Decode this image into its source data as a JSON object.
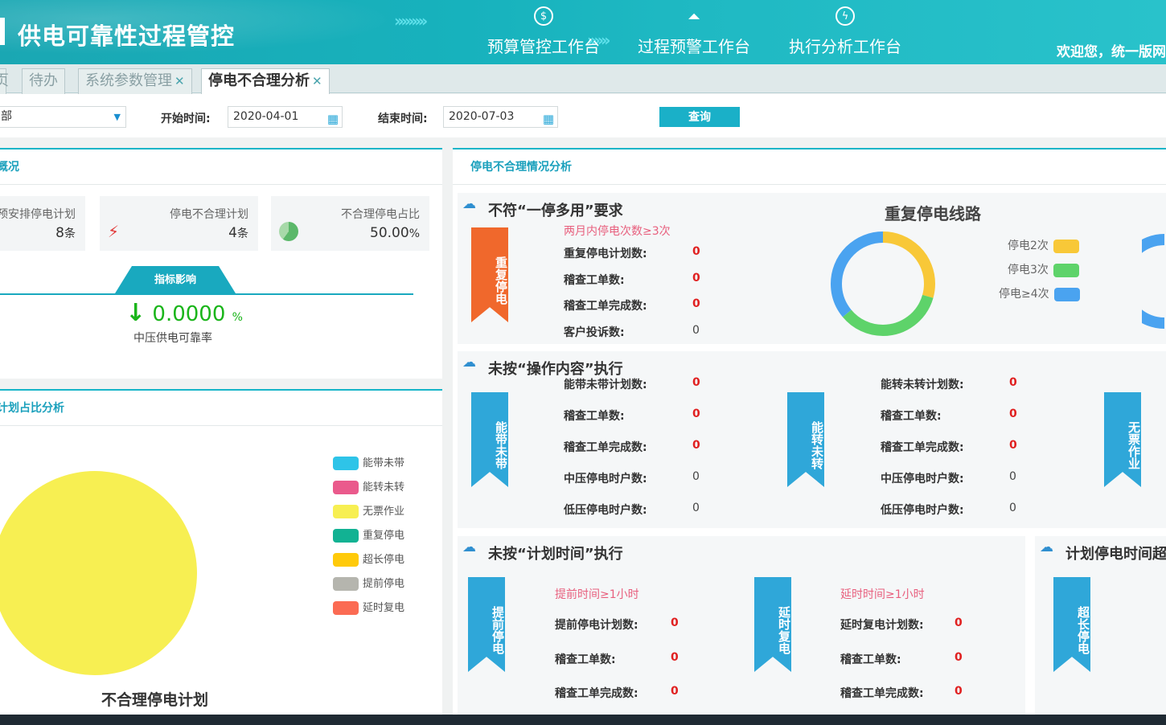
{
  "header": {
    "title": "供电可靠性过程管控",
    "nav": [
      {
        "label": "预算管控工作台",
        "icon": "dollar-icon"
      },
      {
        "label": "过程预警工作台",
        "icon": "alarm-icon"
      },
      {
        "label": "执行分析工作台",
        "icon": "lightning-icon"
      }
    ],
    "welcome": "欢迎您，统一版网"
  },
  "tabs": [
    {
      "label": "页",
      "closable": false,
      "active": false
    },
    {
      "label": "待办",
      "closable": false,
      "active": false
    },
    {
      "label": "系统参数管理",
      "closable": true,
      "active": false
    },
    {
      "label": "停电不合理分析",
      "closable": true,
      "active": true
    }
  ],
  "filter": {
    "org_value": "部",
    "start_label": "开始时间:",
    "start_value": "2020-04-01",
    "end_label": "结束时间:",
    "end_value": "2020-07-03",
    "query_label": "查询"
  },
  "overview": {
    "title": "概况",
    "stats": [
      {
        "label": "预安排停电计划",
        "value": "8",
        "unit": "条"
      },
      {
        "label": "停电不合理计划",
        "value": "4",
        "unit": "条"
      },
      {
        "label": "不合理停电占比",
        "value": "50.00",
        "unit": "%"
      }
    ],
    "index_tab": "指标影响",
    "index_arrow": "↓",
    "index_value": "0.0000",
    "index_unit": "%",
    "index_label": "中压供电可靠率"
  },
  "pie_panel": {
    "title": "计划占比分析",
    "chart_title": "不合理停电计划",
    "legend": [
      {
        "label": "能带未带",
        "color": "#2ec4e8"
      },
      {
        "label": "能转未转",
        "color": "#ea5a8c"
      },
      {
        "label": "无票作业",
        "color": "#f7ef52"
      },
      {
        "label": "重复停电",
        "color": "#12b293"
      },
      {
        "label": "超长停电",
        "color": "#ffca0a"
      },
      {
        "label": "提前停电",
        "color": "#b5b5ae"
      },
      {
        "label": "延时复电",
        "color": "#fb6b53"
      }
    ]
  },
  "chart_data": {
    "type": "pie",
    "title": "不合理停电计划",
    "categories": [
      "能带未带",
      "能转未转",
      "无票作业",
      "重复停电",
      "超长停电",
      "提前停电",
      "延时复电"
    ],
    "values": [
      0,
      0,
      4,
      0,
      0,
      0,
      0
    ]
  },
  "analysis": {
    "title": "停电不合理情况分析",
    "one_stop": {
      "title": "不符“一停多用”要求",
      "ribbon": "重复停电",
      "condition": "两月内停电次数≥3次",
      "rows": [
        {
          "label": "重复停电计划数:",
          "value": "0",
          "red": true
        },
        {
          "label": "稽查工单数:",
          "value": "0",
          "red": true
        },
        {
          "label": "稽查工单完成数:",
          "value": "0",
          "red": true
        },
        {
          "label": "客户投诉数:",
          "value": "0",
          "red": false
        }
      ]
    },
    "repeat_lines": {
      "title": "重复停电线路",
      "legend": [
        {
          "label": "停电2次",
          "color": "#f8c838"
        },
        {
          "label": "停电3次",
          "color": "#5ed36a"
        },
        {
          "label": "停电≥4次",
          "color": "#4aa3f0"
        }
      ]
    },
    "operation": {
      "title": "未按“操作内容”执行",
      "groups": [
        {
          "ribbon": "能带未带",
          "rows": [
            {
              "label": "能带未带计划数:",
              "value": "0",
              "red": true
            },
            {
              "label": "稽查工单数:",
              "value": "0",
              "red": true
            },
            {
              "label": "稽查工单完成数:",
              "value": "0",
              "red": true
            },
            {
              "label": "中压停电时户数:",
              "value": "0",
              "red": false
            },
            {
              "label": "低压停电时户数:",
              "value": "0",
              "red": false
            }
          ]
        },
        {
          "ribbon": "能转未转",
          "rows": [
            {
              "label": "能转未转计划数:",
              "value": "0",
              "red": true
            },
            {
              "label": "稽查工单数:",
              "value": "0",
              "red": true
            },
            {
              "label": "稽查工单完成数:",
              "value": "0",
              "red": true
            },
            {
              "label": "中压停电时户数:",
              "value": "0",
              "red": false
            },
            {
              "label": "低压停电时户数:",
              "value": "0",
              "red": false
            }
          ]
        },
        {
          "ribbon": "无票作业"
        }
      ]
    },
    "plan_time": {
      "title": "未按“计划时间”执行",
      "groups": [
        {
          "ribbon": "提前停电",
          "condition": "提前时间≥1小时",
          "rows": [
            {
              "label": "提前停电计划数:",
              "value": "0",
              "red": true
            },
            {
              "label": "稽查工单数:",
              "value": "0",
              "red": true
            },
            {
              "label": "稽查工单完成数:",
              "value": "0",
              "red": true
            }
          ]
        },
        {
          "ribbon": "延时复电",
          "condition": "延时时间≥1小时",
          "rows": [
            {
              "label": "延时复电计划数:",
              "value": "0",
              "red": true
            },
            {
              "label": "稽查工单数:",
              "value": "0",
              "red": true
            },
            {
              "label": "稽查工单完成数:",
              "value": "0",
              "red": true
            }
          ]
        }
      ]
    },
    "overlong": {
      "title": "计划停电时间超长",
      "ribbon": "超长停电"
    }
  }
}
